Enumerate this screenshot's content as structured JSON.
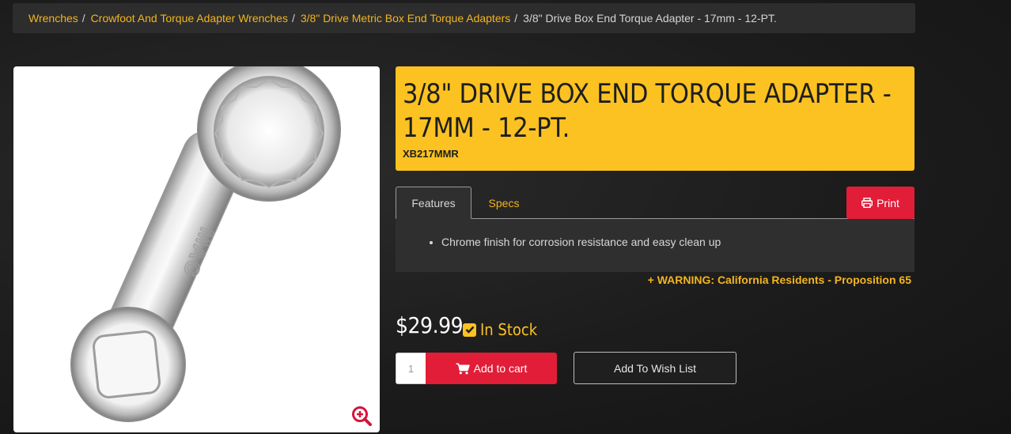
{
  "breadcrumb": {
    "items": [
      "Wrenches",
      "Crowfoot And Torque Adapter Wrenches",
      "3/8\" Drive Metric Box End Torque Adapters"
    ],
    "separator": "/",
    "current": "3/8\" Drive Box End Torque Adapter - 17mm - 12-PT."
  },
  "product": {
    "title": "3/8\" DRIVE BOX END TORQUE ADAPTER - 17MM - 12-PT.",
    "sku": "XB217MMR",
    "image_logo_text": "MAC",
    "price": "$29.99",
    "stock_status": "In Stock"
  },
  "tabs": {
    "features_label": "Features",
    "specs_label": "Specs",
    "print_label": "Print",
    "features_items": [
      "Chrome finish for corrosion resistance and easy clean up"
    ]
  },
  "warning_label": "+ WARNING: California Residents - Proposition 65",
  "cart": {
    "quantity": "1",
    "add_to_cart_label": "Add to cart",
    "wish_list_label": "Add To Wish List"
  },
  "colors": {
    "accent_yellow": "#fbc221",
    "link_gold": "#f3b51e",
    "cta_red": "#e21d38",
    "panel_dark": "#2f2f2f"
  },
  "icons": [
    "magnifier-plus-icon",
    "printer-icon",
    "checkbox-check-icon",
    "shopping-cart-icon"
  ]
}
